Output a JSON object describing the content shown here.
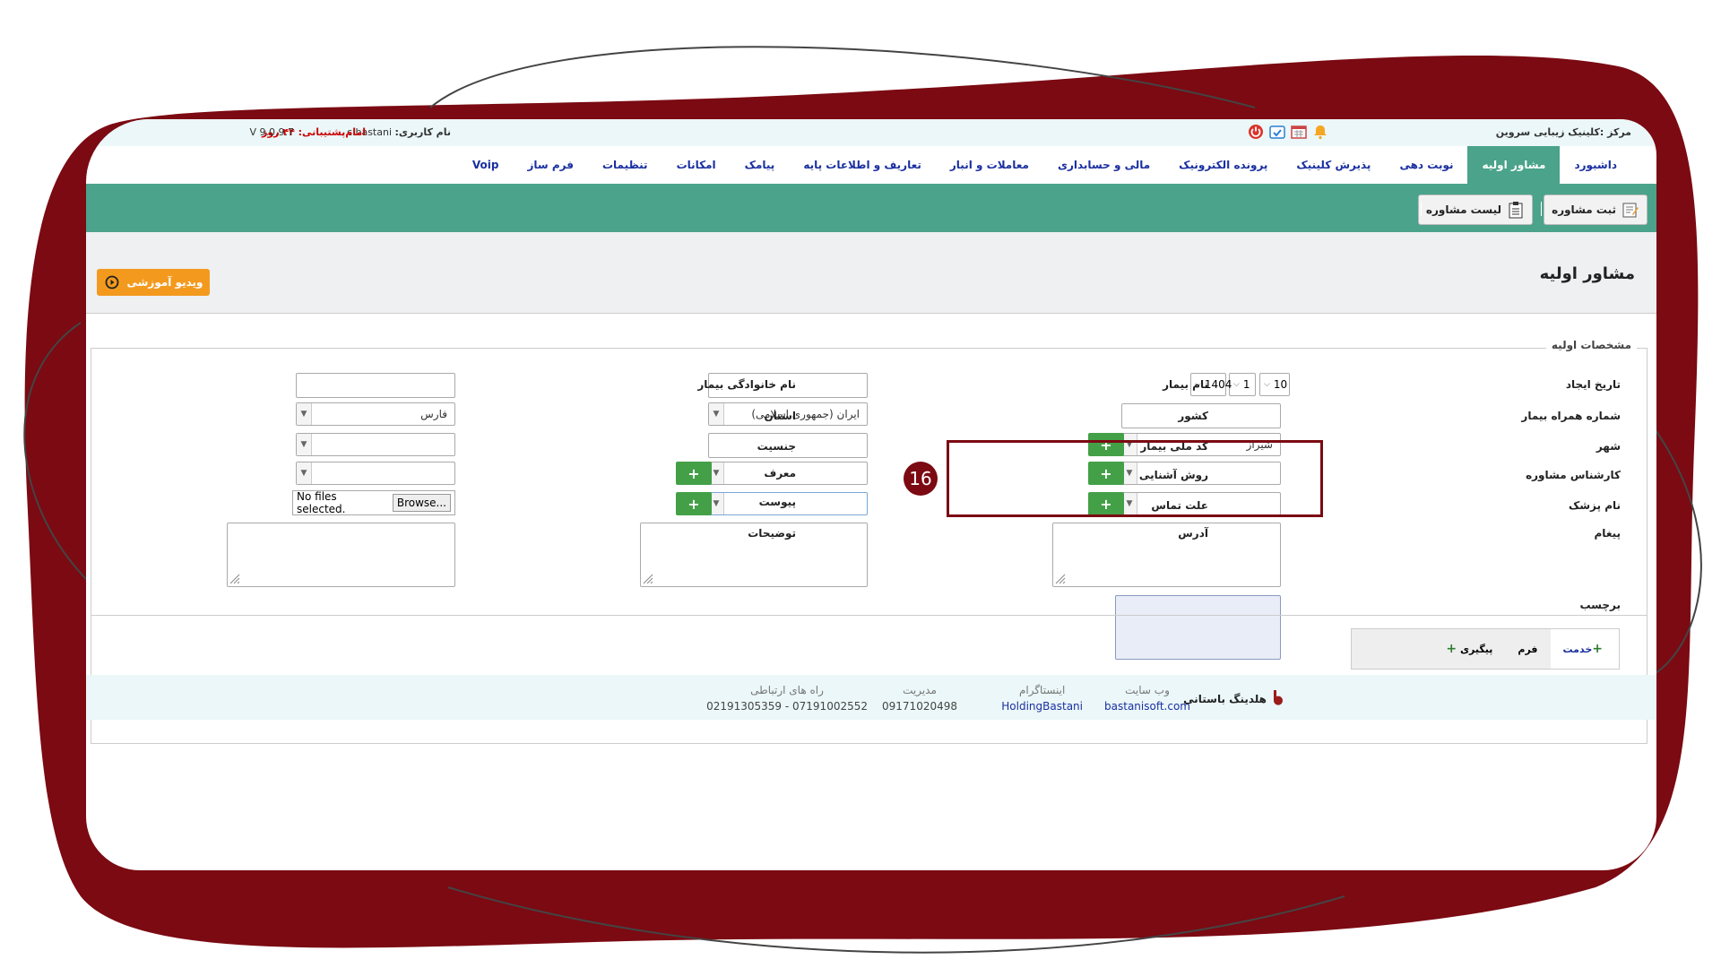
{
  "topbar": {
    "center_name": "مرکز :کلینیک زیبایی سروین",
    "user_label": "نام کاربری:",
    "user_value": "c.bastani",
    "support_text": "امام‌پشتیبانی: ۴۴ روز",
    "version": "V 9.0.9.7"
  },
  "nav": {
    "items": [
      "داشبورد",
      "مشاور اولیه",
      "نوبت دهی",
      "پذیرش کلینیک",
      "پرونده الکترونیک",
      "مالی و حسابداری",
      "معاملات و انبار",
      "تعاریف و اطلاعات پایه",
      "پیامک",
      "امکانات",
      "تنظیمات",
      "فرم ساز",
      "Voip"
    ]
  },
  "toolbar": {
    "register_label": "ثبت مشاوره",
    "list_label": "لیست مشاوره"
  },
  "page": {
    "title": "مشاور اولیه",
    "video_button": "ویدیو آموزشی",
    "section_legend": "مشخصات اولیه"
  },
  "form": {
    "labels": {
      "created_date": "تاریخ ایجاد",
      "patient_mobile": "شماره همراه بیمار",
      "city": "شهر",
      "consultant": "کارشناس مشاوره",
      "doctor": "نام پزشک",
      "message": "پیغام",
      "tag": "برچسب",
      "patient_name": "نام بیمار",
      "country": "کشور",
      "national_code": "کد ملی بیمار",
      "acquaintance": "روش آشنایی",
      "contact_reason": "علت تماس",
      "address": "آدرس",
      "family_name": "نام خانوادگی بیمار",
      "province": "استان",
      "gender": "جنسیت",
      "referrer": "معرف",
      "attachment": "پیوست",
      "description": "توضیحات"
    },
    "date": {
      "day": "10",
      "month": "1",
      "year": "1404"
    },
    "city_value": "شیراز",
    "country_value": "ایران (جمهوری اسلامی)",
    "province_value": "فارس",
    "file_status": "No files selected.",
    "browse_label": "Browse..."
  },
  "annotation": {
    "step": "16"
  },
  "tabs": {
    "service_label": "خدمت",
    "form_label": "فرم",
    "followup_label": "پیگیری"
  },
  "footer": {
    "brand": "هلدینگ باستانی",
    "website_label": "وب سایت",
    "website_value": "bastanisoft.com",
    "instagram_label": "اینستاگرام",
    "instagram_value": "HoldingBastani",
    "management_label": "مدیریت",
    "management_value": "09171020498",
    "contacts_label": "راه های ارتباطی",
    "contacts_value": "07191002552 - 02191305359"
  },
  "colors": {
    "accent": "#4aa38a",
    "frame": "#7b0a12",
    "orange": "#f39a1e",
    "nav_text": "#1a2fa0"
  }
}
